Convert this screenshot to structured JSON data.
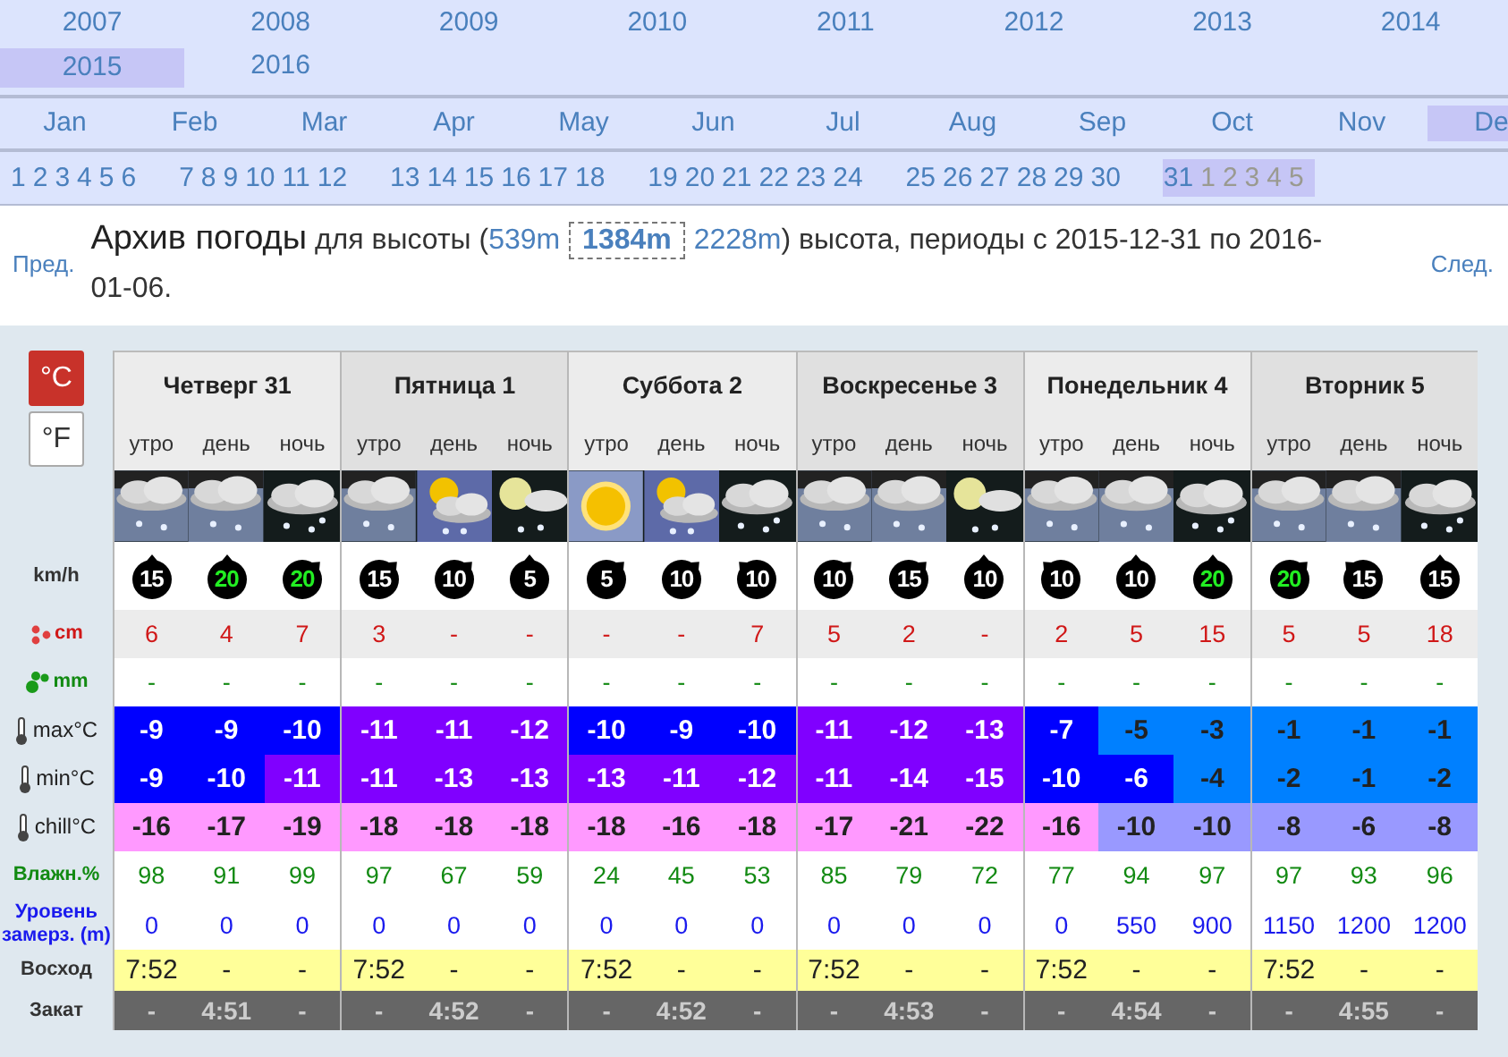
{
  "years": [
    {
      "label": "2007",
      "selected": false
    },
    {
      "label": "2008",
      "selected": false
    },
    {
      "label": "2009",
      "selected": false
    },
    {
      "label": "2010",
      "selected": false
    },
    {
      "label": "2011",
      "selected": false
    },
    {
      "label": "2012",
      "selected": false
    },
    {
      "label": "2013",
      "selected": false
    },
    {
      "label": "2014",
      "selected": false
    },
    {
      "label": "2015",
      "selected": true
    },
    {
      "label": "2016",
      "selected": false
    }
  ],
  "months": [
    {
      "label": "Jan",
      "selected": false
    },
    {
      "label": "Feb",
      "selected": false
    },
    {
      "label": "Mar",
      "selected": false
    },
    {
      "label": "Apr",
      "selected": false
    },
    {
      "label": "May",
      "selected": false
    },
    {
      "label": "Jun",
      "selected": false
    },
    {
      "label": "Jul",
      "selected": false
    },
    {
      "label": "Aug",
      "selected": false
    },
    {
      "label": "Sep",
      "selected": false
    },
    {
      "label": "Oct",
      "selected": false
    },
    {
      "label": "Nov",
      "selected": false
    },
    {
      "label": "De",
      "selected": true
    }
  ],
  "day_groups": [
    {
      "selected": false,
      "days": [
        {
          "label": "1",
          "muted": false
        },
        {
          "label": "2",
          "muted": false
        },
        {
          "label": "3",
          "muted": false
        },
        {
          "label": "4",
          "muted": false
        },
        {
          "label": "5",
          "muted": false
        },
        {
          "label": "6",
          "muted": false
        }
      ]
    },
    {
      "selected": false,
      "days": [
        {
          "label": "7",
          "muted": false
        },
        {
          "label": "8",
          "muted": false
        },
        {
          "label": "9",
          "muted": false
        },
        {
          "label": "10",
          "muted": false
        },
        {
          "label": "11",
          "muted": false
        },
        {
          "label": "12",
          "muted": false
        }
      ]
    },
    {
      "selected": false,
      "days": [
        {
          "label": "13",
          "muted": false
        },
        {
          "label": "14",
          "muted": false
        },
        {
          "label": "15",
          "muted": false
        },
        {
          "label": "16",
          "muted": false
        },
        {
          "label": "17",
          "muted": false
        },
        {
          "label": "18",
          "muted": false
        }
      ]
    },
    {
      "selected": false,
      "days": [
        {
          "label": "19",
          "muted": false
        },
        {
          "label": "20",
          "muted": false
        },
        {
          "label": "21",
          "muted": false
        },
        {
          "label": "22",
          "muted": false
        },
        {
          "label": "23",
          "muted": false
        },
        {
          "label": "24",
          "muted": false
        }
      ]
    },
    {
      "selected": false,
      "days": [
        {
          "label": "25",
          "muted": false
        },
        {
          "label": "26",
          "muted": false
        },
        {
          "label": "27",
          "muted": false
        },
        {
          "label": "28",
          "muted": false
        },
        {
          "label": "29",
          "muted": false
        },
        {
          "label": "30",
          "muted": false
        }
      ]
    },
    {
      "selected": true,
      "days": [
        {
          "label": "31",
          "muted": false
        },
        {
          "label": "1",
          "muted": true
        },
        {
          "label": "2",
          "muted": true
        },
        {
          "label": "3",
          "muted": true
        },
        {
          "label": "4",
          "muted": true
        },
        {
          "label": "5",
          "muted": true
        }
      ]
    }
  ],
  "heading": {
    "prev": "Пред.",
    "next": "След.",
    "title": "Архив погоды",
    "before": "для высоты (",
    "altitudes": [
      {
        "label": "539m",
        "selected": false
      },
      {
        "label": "1384m",
        "selected": true
      },
      {
        "label": "2228m",
        "selected": false
      }
    ],
    "after": ") высота, периоды с 2015-12-31 по 2016-01-06."
  },
  "units": [
    {
      "label": "°C",
      "selected": true
    },
    {
      "label": "°F",
      "selected": false
    }
  ],
  "wind_unit": "km/h",
  "days": [
    {
      "name": "Четверг 31",
      "periods": [
        {
          "label": "утро",
          "sky": {
            "kind": "snowy"
          },
          "wind": {
            "kind": "north",
            "speed": "15",
            "strong": false
          }
        },
        {
          "label": "день",
          "sky": {
            "kind": "snowy"
          },
          "wind": {
            "kind": "north",
            "speed": "20",
            "strong": true
          }
        },
        {
          "label": "ночь",
          "sky": {
            "kind": "nightsnow"
          },
          "wind": {
            "kind": "northeast",
            "speed": "20",
            "strong": true
          }
        }
      ]
    },
    {
      "name": "Пятница 1",
      "periods": [
        {
          "label": "утро",
          "sky": {
            "kind": "snowy"
          },
          "wind": {
            "kind": "northeast",
            "speed": "15",
            "strong": false
          }
        },
        {
          "label": "день",
          "sky": {
            "kind": "sunsnow"
          },
          "wind": {
            "kind": "northeast",
            "speed": "10",
            "strong": false
          }
        },
        {
          "label": "ночь",
          "sky": {
            "kind": "moonsnow"
          },
          "wind": {
            "kind": "north",
            "speed": "5",
            "strong": false
          }
        }
      ]
    },
    {
      "name": "Суббота 2",
      "periods": [
        {
          "label": "утро",
          "sky": {
            "kind": "sunny"
          },
          "wind": {
            "kind": "northeast",
            "speed": "5",
            "strong": false
          }
        },
        {
          "label": "день",
          "sky": {
            "kind": "sunsnow"
          },
          "wind": {
            "kind": "northeast",
            "speed": "10",
            "strong": false
          }
        },
        {
          "label": "ночь",
          "sky": {
            "kind": "nightsnow"
          },
          "wind": {
            "kind": "northwest",
            "speed": "10",
            "strong": false
          }
        }
      ]
    },
    {
      "name": "Воскресенье 3",
      "periods": [
        {
          "label": "утро",
          "sky": {
            "kind": "snowy"
          },
          "wind": {
            "kind": "northeast",
            "speed": "10",
            "strong": false
          }
        },
        {
          "label": "день",
          "sky": {
            "kind": "snowy"
          },
          "wind": {
            "kind": "northeast",
            "speed": "15",
            "strong": false
          }
        },
        {
          "label": "ночь",
          "sky": {
            "kind": "moonsnow"
          },
          "wind": {
            "kind": "north",
            "speed": "10",
            "strong": false
          }
        }
      ]
    },
    {
      "name": "Понедельник 4",
      "periods": [
        {
          "label": "утро",
          "sky": {
            "kind": "snowy"
          },
          "wind": {
            "kind": "northwest",
            "speed": "10",
            "strong": false
          }
        },
        {
          "label": "день",
          "sky": {
            "kind": "snowy"
          },
          "wind": {
            "kind": "north",
            "speed": "10",
            "strong": false
          }
        },
        {
          "label": "ночь",
          "sky": {
            "kind": "nightsnow"
          },
          "wind": {
            "kind": "north",
            "speed": "20",
            "strong": true
          }
        }
      ]
    },
    {
      "name": "Вторник 5",
      "periods": [
        {
          "label": "утро",
          "sky": {
            "kind": "snowy"
          },
          "wind": {
            "kind": "northeast",
            "speed": "20",
            "strong": true
          }
        },
        {
          "label": "день",
          "sky": {
            "kind": "snowy"
          },
          "wind": {
            "kind": "northwest",
            "speed": "15",
            "strong": false
          }
        },
        {
          "label": "ночь",
          "sky": {
            "kind": "nightsnow"
          },
          "wind": {
            "kind": "north",
            "speed": "15",
            "strong": false
          }
        }
      ]
    }
  ],
  "rows": [
    {
      "kind": "snow",
      "label": "cm",
      "cells": [
        "6",
        "4",
        "7",
        "3",
        "-",
        "-",
        "-",
        "-",
        "7",
        "5",
        "2",
        "-",
        "2",
        "5",
        "15",
        "5",
        "5",
        "18"
      ]
    },
    {
      "kind": "rain",
      "label": "mm",
      "cells": [
        "-",
        "-",
        "-",
        "-",
        "-",
        "-",
        "-",
        "-",
        "-",
        "-",
        "-",
        "-",
        "-",
        "-",
        "-",
        "-",
        "-",
        "-"
      ]
    },
    {
      "kind": "temp",
      "label": "max°C",
      "cells": [
        {
          "value": "-9",
          "color": "#0000ff"
        },
        {
          "value": "-9",
          "color": "#0000ff"
        },
        {
          "value": "-10",
          "color": "#0000ff"
        },
        {
          "value": "-11",
          "color": "#8000ff"
        },
        {
          "value": "-11",
          "color": "#8000ff"
        },
        {
          "value": "-12",
          "color": "#8000ff"
        },
        {
          "value": "-10",
          "color": "#0000ff"
        },
        {
          "value": "-9",
          "color": "#0000ff"
        },
        {
          "value": "-10",
          "color": "#0000ff"
        },
        {
          "value": "-11",
          "color": "#8000ff"
        },
        {
          "value": "-12",
          "color": "#8000ff"
        },
        {
          "value": "-13",
          "color": "#8000ff"
        },
        {
          "value": "-7",
          "color": "#0000ff"
        },
        {
          "value": "-5",
          "color": "#0080ff"
        },
        {
          "value": "-3",
          "color": "#0080ff"
        },
        {
          "value": "-1",
          "color": "#0080ff"
        },
        {
          "value": "-1",
          "color": "#0080ff"
        },
        {
          "value": "-1",
          "color": "#0080ff"
        }
      ]
    },
    {
      "kind": "temp",
      "label": "min°C",
      "cells": [
        {
          "value": "-9",
          "color": "#0000ff"
        },
        {
          "value": "-10",
          "color": "#0000ff"
        },
        {
          "value": "-11",
          "color": "#8000ff"
        },
        {
          "value": "-11",
          "color": "#8000ff"
        },
        {
          "value": "-13",
          "color": "#8000ff"
        },
        {
          "value": "-13",
          "color": "#8000ff"
        },
        {
          "value": "-13",
          "color": "#8000ff"
        },
        {
          "value": "-11",
          "color": "#8000ff"
        },
        {
          "value": "-12",
          "color": "#8000ff"
        },
        {
          "value": "-11",
          "color": "#8000ff"
        },
        {
          "value": "-14",
          "color": "#8000ff"
        },
        {
          "value": "-15",
          "color": "#8000ff"
        },
        {
          "value": "-10",
          "color": "#0000ff"
        },
        {
          "value": "-6",
          "color": "#0000ff"
        },
        {
          "value": "-4",
          "color": "#0080ff"
        },
        {
          "value": "-2",
          "color": "#0080ff"
        },
        {
          "value": "-1",
          "color": "#0080ff"
        },
        {
          "value": "-2",
          "color": "#0080ff"
        }
      ]
    },
    {
      "kind": "temp",
      "label": "chill°C",
      "cells": [
        {
          "value": "-16",
          "color": "#ff99ff"
        },
        {
          "value": "-17",
          "color": "#ff99ff"
        },
        {
          "value": "-19",
          "color": "#ff99ff"
        },
        {
          "value": "-18",
          "color": "#ff99ff"
        },
        {
          "value": "-18",
          "color": "#ff99ff"
        },
        {
          "value": "-18",
          "color": "#ff99ff"
        },
        {
          "value": "-18",
          "color": "#ff99ff"
        },
        {
          "value": "-16",
          "color": "#ff99ff"
        },
        {
          "value": "-18",
          "color": "#ff99ff"
        },
        {
          "value": "-17",
          "color": "#ff99ff"
        },
        {
          "value": "-21",
          "color": "#ff99ff"
        },
        {
          "value": "-22",
          "color": "#ff99ff"
        },
        {
          "value": "-16",
          "color": "#ff99ff"
        },
        {
          "value": "-10",
          "color": "#9999ff"
        },
        {
          "value": "-10",
          "color": "#9999ff"
        },
        {
          "value": "-8",
          "color": "#9999ff"
        },
        {
          "value": "-6",
          "color": "#9999ff"
        },
        {
          "value": "-8",
          "color": "#9999ff"
        }
      ]
    },
    {
      "kind": "humidity",
      "label": "Влажн.%",
      "cells": [
        "98",
        "91",
        "99",
        "97",
        "67",
        "59",
        "24",
        "45",
        "53",
        "85",
        "79",
        "72",
        "77",
        "94",
        "97",
        "97",
        "93",
        "96"
      ]
    },
    {
      "kind": "freeze",
      "label": "Уровень замерз. (m)",
      "cells": [
        "0",
        "0",
        "0",
        "0",
        "0",
        "0",
        "0",
        "0",
        "0",
        "0",
        "0",
        "0",
        "0",
        "550",
        "900",
        "1150",
        "1200",
        "1200"
      ]
    },
    {
      "kind": "sunrise",
      "label": "Восход",
      "cells": [
        "7:52",
        "-",
        "-",
        "7:52",
        "-",
        "-",
        "7:52",
        "-",
        "-",
        "7:52",
        "-",
        "-",
        "7:52",
        "-",
        "-",
        "7:52",
        "-",
        "-"
      ]
    },
    {
      "kind": "sunset",
      "label": "Закат",
      "cells": [
        "-",
        "4:51",
        "-",
        "-",
        "4:52",
        "-",
        "-",
        "4:52",
        "-",
        "-",
        "4:53",
        "-",
        "-",
        "4:54",
        "-",
        "-",
        "4:55",
        "-"
      ]
    }
  ]
}
